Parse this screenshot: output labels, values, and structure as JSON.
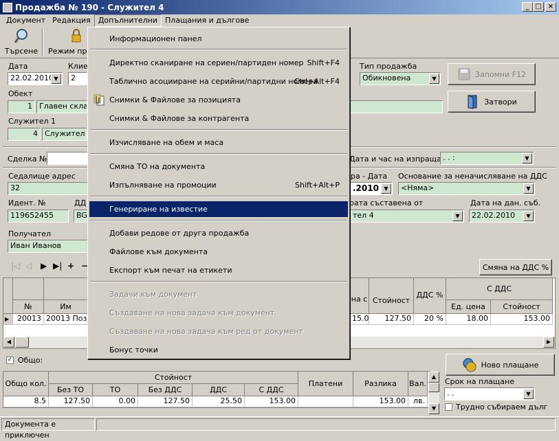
{
  "window": {
    "title": "Продажба № 190 - Служител 4"
  },
  "menubar": [
    "Документ",
    "Редакция",
    "Допълнителни",
    "Плащания и дългове"
  ],
  "toolbar": {
    "search": "Търсене",
    "mode": "Режим пре"
  },
  "form": {
    "date_label": "Дата",
    "date_value": "22.02.2010",
    "client_label": "Клие",
    "client_value": "2",
    "sale_type_label": "Тип продажба",
    "sale_type_value": "Обикновена",
    "save_button": "Запомни F12",
    "close_button": "Затвори",
    "object_label": "Обект",
    "object_id": "1",
    "object_name": "Главен склад",
    "employee_label": "Служител 1",
    "employee_id": "4",
    "employee_name": "Служител 4",
    "deal_label": "Сделка №",
    "ship_label": "Дата и час на изпращане",
    "ship_value": ". .    :",
    "address_label": "Седалище адрес",
    "address_value": "32",
    "invoice_date_label": "ра - Дата",
    "invoice_date_value": ".2010",
    "vat_reason_label": "Основание за неначисляване на ДДС",
    "vat_reason_value": "<Няма>",
    "ident_label": "Идент. №",
    "ident_value": "119652455",
    "dd_label": "ДД",
    "dd_value": "BG",
    "issued_by_label": "рата съставена от",
    "issued_by_value": "тел 4",
    "tax_date_label": "Дата на дан. съб.",
    "tax_date_value": "22.02.2010",
    "recipient_label": "Получател",
    "recipient_value": "Иван Иванов"
  },
  "grid": {
    "change_vat_button": "Смяна на ДДС %",
    "headers": {
      "no": "№",
      "name": "Им",
      "price_with": "на с",
      "value": "Стойност",
      "vat": "ДДС %",
      "with_vat": "С ДДС",
      "unit_price": "Ед. цена",
      "total": "Стойност"
    },
    "rows": [
      {
        "no": "20013",
        "name": "20013 Пози",
        "price_with": "15.00",
        "value": "127.50",
        "vat": "20 %",
        "unit_price": "18.00",
        "total": "153.00"
      }
    ]
  },
  "totals": {
    "checkbox_label": "Общо:",
    "new_payment_button": "Ново плащане",
    "headers": {
      "qty": "Общо кол.",
      "value": "Стойност",
      "no_to": "Без ТО",
      "to": "ТО",
      "no_vat": "Без ДДС",
      "vat": "ДДС",
      "with_vat": "С ДДС",
      "paid": "Платени",
      "diff": "Разлика",
      "cur": "Вал."
    },
    "values": {
      "qty": "8.5",
      "no_to": "127.50",
      "to": "0.00",
      "no_vat": "127.50",
      "vat": "25.50",
      "with_vat": "153.00",
      "paid": "",
      "diff": "153.00",
      "cur": "лв."
    },
    "due_label": "Срок на плащане",
    "due_value": ". .",
    "hard_debt_label": "Трудно събираем дълг"
  },
  "status": {
    "text": "Документа е приключен"
  },
  "menu": {
    "items": [
      {
        "label": "Информационен панел",
        "shortcut": ""
      },
      {
        "label": "Директно сканиране на сериен/партиден номер",
        "shortcut": "Shift+F4"
      },
      {
        "label": "Таблично асоцииране на серийни/партидни номера",
        "shortcut": "Ctrl+Alt+F4"
      },
      {
        "label": "Снимки & Файлове за позицията",
        "shortcut": ""
      },
      {
        "label": "Снимки & Файлове за контрагента",
        "shortcut": ""
      },
      {
        "label": "Изчисляване на обем и маса",
        "shortcut": ""
      },
      {
        "label": "Смяна ТО на документа",
        "shortcut": ""
      },
      {
        "label": "Изпълняване на промоции",
        "shortcut": "Shift+Alt+P"
      },
      {
        "label": "Генериране на известие",
        "shortcut": ""
      },
      {
        "label": "Добави редове от друга продажба",
        "shortcut": ""
      },
      {
        "label": "Файлове към документа",
        "shortcut": ""
      },
      {
        "label": "Експорт към печат на етикети",
        "shortcut": ""
      },
      {
        "label": "Задачи към документ",
        "shortcut": ""
      },
      {
        "label": "Създаване на нова задача към документ",
        "shortcut": ""
      },
      {
        "label": "Създаване на нова задача към ред от документ",
        "shortcut": ""
      },
      {
        "label": "Бонус точки",
        "shortcut": ""
      }
    ]
  }
}
